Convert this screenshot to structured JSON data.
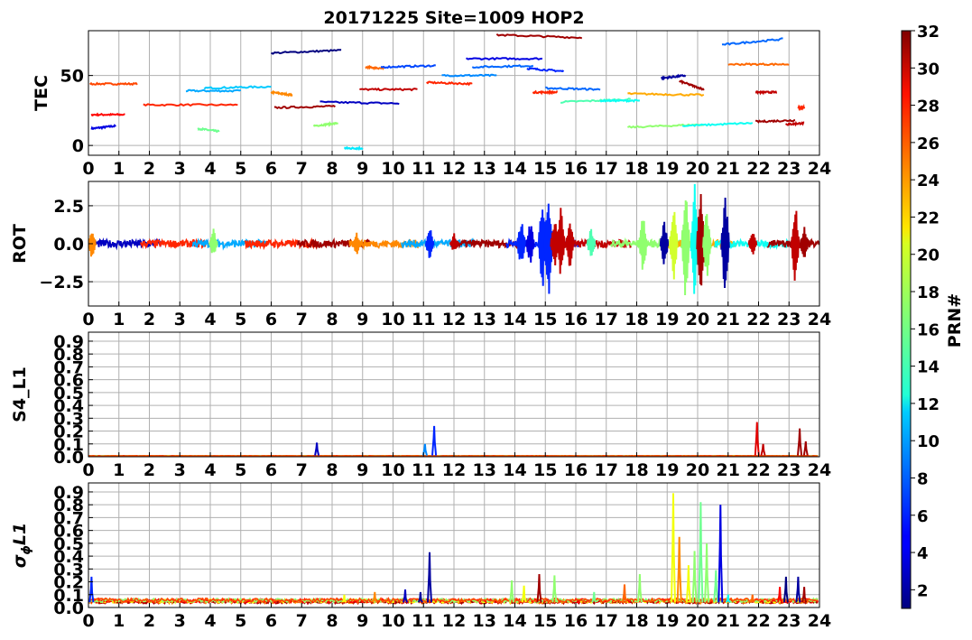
{
  "figure": {
    "title": "20171225 Site=1009 HOP2"
  },
  "chart_data": [
    {
      "type": "line",
      "panel": "TEC",
      "ylabel": "TEC",
      "xlim": [
        0,
        24
      ],
      "ylim": [
        -7,
        82
      ],
      "xticks": [
        0,
        1,
        2,
        3,
        4,
        5,
        6,
        7,
        8,
        9,
        10,
        11,
        12,
        13,
        14,
        15,
        16,
        17,
        18,
        19,
        20,
        21,
        22,
        23,
        24
      ],
      "yticks": [
        0,
        50
      ],
      "grid": true,
      "series": [
        {
          "prn": 4,
          "x": [
            0.1,
            0.9
          ],
          "y": [
            12,
            14
          ]
        },
        {
          "prn": 28,
          "x": [
            0.1,
            1.2
          ],
          "y": [
            22,
            22
          ]
        },
        {
          "prn": 26,
          "x": [
            0.05,
            1.6
          ],
          "y": [
            44,
            44
          ]
        },
        {
          "prn": 27,
          "x": [
            1.8,
            4.9
          ],
          "y": [
            29,
            29
          ]
        },
        {
          "prn": 10,
          "x": [
            3.2,
            5.0
          ],
          "y": [
            39,
            39
          ]
        },
        {
          "prn": 11,
          "x": [
            3.8,
            6.0
          ],
          "y": [
            41,
            42
          ]
        },
        {
          "prn": 16,
          "x": [
            3.6,
            4.3
          ],
          "y": [
            12,
            10
          ]
        },
        {
          "prn": 24,
          "x": [
            6.0,
            6.7
          ],
          "y": [
            38,
            36
          ]
        },
        {
          "prn": 1,
          "x": [
            6.0,
            8.3
          ],
          "y": [
            66,
            68
          ]
        },
        {
          "prn": 31,
          "x": [
            6.1,
            8.1
          ],
          "y": [
            27,
            28
          ]
        },
        {
          "prn": 17,
          "x": [
            7.4,
            8.2
          ],
          "y": [
            14,
            16
          ]
        },
        {
          "prn": 3,
          "x": [
            7.6,
            10.2
          ],
          "y": [
            31,
            30
          ]
        },
        {
          "prn": 12,
          "x": [
            8.4,
            9.0
          ],
          "y": [
            -2,
            -2
          ]
        },
        {
          "prn": 30,
          "x": [
            8.9,
            10.8
          ],
          "y": [
            40,
            40
          ]
        },
        {
          "prn": 25,
          "x": [
            9.1,
            9.7
          ],
          "y": [
            56,
            55
          ]
        },
        {
          "prn": 7,
          "x": [
            9.6,
            11.4
          ],
          "y": [
            56,
            57
          ]
        },
        {
          "prn": 27,
          "x": [
            11.1,
            12.6
          ],
          "y": [
            45,
            44
          ]
        },
        {
          "prn": 9,
          "x": [
            11.6,
            13.4
          ],
          "y": [
            50,
            50
          ]
        },
        {
          "prn": 4,
          "x": [
            12.4,
            14.9
          ],
          "y": [
            62,
            62
          ]
        },
        {
          "prn": 8,
          "x": [
            12.6,
            14.6
          ],
          "y": [
            56,
            57
          ]
        },
        {
          "prn": 31,
          "x": [
            13.4,
            16.2
          ],
          "y": [
            79,
            77
          ]
        },
        {
          "prn": 6,
          "x": [
            14.4,
            15.6
          ],
          "y": [
            55,
            53
          ]
        },
        {
          "prn": 27,
          "x": [
            14.6,
            15.4
          ],
          "y": [
            38,
            38
          ]
        },
        {
          "prn": 8,
          "x": [
            15.0,
            16.8
          ],
          "y": [
            41,
            40
          ]
        },
        {
          "prn": 15,
          "x": [
            15.5,
            17.8
          ],
          "y": [
            31,
            33
          ]
        },
        {
          "prn": 13,
          "x": [
            16.8,
            18.1
          ],
          "y": [
            32,
            32
          ]
        },
        {
          "prn": 23,
          "x": [
            17.7,
            20.2
          ],
          "y": [
            37,
            36
          ]
        },
        {
          "prn": 17,
          "x": [
            17.7,
            20.2
          ],
          "y": [
            13,
            15
          ]
        },
        {
          "prn": 2,
          "x": [
            18.8,
            19.6
          ],
          "y": [
            48,
            50
          ]
        },
        {
          "prn": 31,
          "x": [
            19.4,
            20.2
          ],
          "y": [
            46,
            40
          ]
        },
        {
          "prn": 13,
          "x": [
            19.5,
            21.8
          ],
          "y": [
            14,
            16
          ]
        },
        {
          "prn": 8,
          "x": [
            20.8,
            22.8
          ],
          "y": [
            72,
            76
          ]
        },
        {
          "prn": 25,
          "x": [
            21.0,
            23.0
          ],
          "y": [
            58,
            58
          ]
        },
        {
          "prn": 30,
          "x": [
            21.9,
            22.6
          ],
          "y": [
            38,
            38
          ]
        },
        {
          "prn": 31,
          "x": [
            21.9,
            23.2
          ],
          "y": [
            17,
            18
          ]
        },
        {
          "prn": 30,
          "x": [
            22.9,
            23.5
          ],
          "y": [
            15,
            16
          ]
        },
        {
          "prn": 27,
          "x": [
            23.3,
            23.5
          ],
          "y": [
            27,
            27
          ]
        }
      ]
    },
    {
      "type": "line",
      "panel": "ROT",
      "ylabel": "ROT",
      "xlim": [
        0,
        24
      ],
      "ylim": [
        -4.1,
        4.1
      ],
      "xticks": [
        0,
        1,
        2,
        3,
        4,
        5,
        6,
        7,
        8,
        9,
        10,
        11,
        12,
        13,
        14,
        15,
        16,
        17,
        18,
        19,
        20,
        21,
        22,
        23,
        24
      ],
      "yticks": [
        -2.5,
        0.0,
        2.5
      ],
      "ytick_labels": [
        "−2.5",
        "0.0",
        "2.5"
      ],
      "grid": true,
      "bursts": [
        {
          "x": 0.1,
          "amp": 1.2,
          "prn": 24
        },
        {
          "x": 4.1,
          "amp": 1.0,
          "prn": 17
        },
        {
          "x": 8.8,
          "amp": 0.8,
          "prn": 24
        },
        {
          "x": 11.2,
          "amp": 1.3,
          "prn": 6
        },
        {
          "x": 12.0,
          "amp": 0.7,
          "prn": 30
        },
        {
          "x": 14.2,
          "amp": 1.8,
          "prn": 6
        },
        {
          "x": 14.5,
          "amp": 1.6,
          "prn": 4
        },
        {
          "x": 14.9,
          "amp": 3.2,
          "prn": 6
        },
        {
          "x": 15.1,
          "amp": 3.8,
          "prn": 6
        },
        {
          "x": 15.3,
          "amp": 2.0,
          "prn": 30
        },
        {
          "x": 15.5,
          "amp": 2.5,
          "prn": 30
        },
        {
          "x": 15.8,
          "amp": 1.8,
          "prn": 30
        },
        {
          "x": 16.5,
          "amp": 1.2,
          "prn": 15
        },
        {
          "x": 18.2,
          "amp": 2.1,
          "prn": 17
        },
        {
          "x": 18.9,
          "amp": 1.7,
          "prn": 2
        },
        {
          "x": 19.2,
          "amp": 2.8,
          "prn": 19
        },
        {
          "x": 19.6,
          "amp": 3.9,
          "prn": 17
        },
        {
          "x": 19.9,
          "amp": 4.0,
          "prn": 13
        },
        {
          "x": 20.1,
          "amp": 3.9,
          "prn": 31
        },
        {
          "x": 20.3,
          "amp": 2.5,
          "prn": 17
        },
        {
          "x": 20.9,
          "amp": 3.8,
          "prn": 2
        },
        {
          "x": 21.8,
          "amp": 0.9,
          "prn": 30
        },
        {
          "x": 23.2,
          "amp": 2.9,
          "prn": 30
        },
        {
          "x": 23.5,
          "amp": 1.4,
          "prn": 31
        }
      ]
    },
    {
      "type": "line",
      "panel": "S4",
      "ylabel": "S4_L1",
      "xlim": [
        0,
        24
      ],
      "ylim": [
        0,
        0.97
      ],
      "xticks": [
        0,
        1,
        2,
        3,
        4,
        5,
        6,
        7,
        8,
        9,
        10,
        11,
        12,
        13,
        14,
        15,
        16,
        17,
        18,
        19,
        20,
        21,
        22,
        23,
        24
      ],
      "yticks": [
        0.0,
        0.1,
        0.2,
        0.3,
        0.4,
        0.5,
        0.6,
        0.7,
        0.8,
        0.9
      ],
      "ytick_labels": [
        "0.0",
        "0.1",
        "0.2",
        "0.3",
        "0.4",
        "0.5",
        "0.6",
        "0.7",
        "0.8",
        "0.9"
      ],
      "grid": true,
      "spikes": [
        {
          "x": 7.5,
          "y": 0.11,
          "prn": 3
        },
        {
          "x": 11.05,
          "y": 0.1,
          "prn": 9
        },
        {
          "x": 11.35,
          "y": 0.24,
          "prn": 6
        },
        {
          "x": 21.95,
          "y": 0.27,
          "prn": 29
        },
        {
          "x": 22.15,
          "y": 0.1,
          "prn": 30
        },
        {
          "x": 23.35,
          "y": 0.22,
          "prn": 31
        },
        {
          "x": 23.55,
          "y": 0.12,
          "prn": 31
        }
      ]
    },
    {
      "type": "line",
      "panel": "sigma_phi",
      "ylabel": "σ",
      "ylabel_sub": "ϕ",
      "ylabel_suffix": "L1",
      "xlim": [
        0,
        24
      ],
      "ylim": [
        0,
        0.97
      ],
      "xticks": [
        0,
        1,
        2,
        3,
        4,
        5,
        6,
        7,
        8,
        9,
        10,
        11,
        12,
        13,
        14,
        15,
        16,
        17,
        18,
        19,
        20,
        21,
        22,
        23,
        24
      ],
      "yticks": [
        0.0,
        0.1,
        0.2,
        0.3,
        0.4,
        0.5,
        0.6,
        0.7,
        0.8,
        0.9
      ],
      "ytick_labels": [
        "0.0",
        "0.1",
        "0.2",
        "0.3",
        "0.4",
        "0.5",
        "0.6",
        "0.7",
        "0.8",
        "0.9"
      ],
      "grid": true,
      "spikes": [
        {
          "x": 0.1,
          "y": 0.24,
          "prn": 6
        },
        {
          "x": 8.4,
          "y": 0.1,
          "prn": 20
        },
        {
          "x": 9.4,
          "y": 0.12,
          "prn": 24
        },
        {
          "x": 10.4,
          "y": 0.14,
          "prn": 3
        },
        {
          "x": 10.9,
          "y": 0.12,
          "prn": 2
        },
        {
          "x": 11.2,
          "y": 0.43,
          "prn": 2
        },
        {
          "x": 13.9,
          "y": 0.21,
          "prn": 17
        },
        {
          "x": 14.3,
          "y": 0.17,
          "prn": 20
        },
        {
          "x": 14.8,
          "y": 0.26,
          "prn": 31
        },
        {
          "x": 15.3,
          "y": 0.25,
          "prn": 17
        },
        {
          "x": 16.6,
          "y": 0.12,
          "prn": 16
        },
        {
          "x": 17.6,
          "y": 0.18,
          "prn": 25
        },
        {
          "x": 18.1,
          "y": 0.26,
          "prn": 17
        },
        {
          "x": 19.2,
          "y": 0.89,
          "prn": 20
        },
        {
          "x": 19.4,
          "y": 0.55,
          "prn": 24
        },
        {
          "x": 19.7,
          "y": 0.33,
          "prn": 20
        },
        {
          "x": 19.9,
          "y": 0.44,
          "prn": 17
        },
        {
          "x": 20.1,
          "y": 0.82,
          "prn": 16
        },
        {
          "x": 20.3,
          "y": 0.5,
          "prn": 17
        },
        {
          "x": 20.6,
          "y": 0.29,
          "prn": 16
        },
        {
          "x": 20.75,
          "y": 0.8,
          "prn": 4
        },
        {
          "x": 21.0,
          "y": 0.1,
          "prn": 13
        },
        {
          "x": 21.8,
          "y": 0.1,
          "prn": 25
        },
        {
          "x": 22.7,
          "y": 0.16,
          "prn": 28
        },
        {
          "x": 22.9,
          "y": 0.24,
          "prn": 1
        },
        {
          "x": 23.3,
          "y": 0.24,
          "prn": 2
        },
        {
          "x": 23.5,
          "y": 0.16,
          "prn": 31
        }
      ]
    }
  ],
  "colorbar": {
    "label": "PRN#",
    "min": 1,
    "max": 32,
    "ticks": [
      2,
      4,
      6,
      8,
      10,
      12,
      14,
      16,
      18,
      20,
      22,
      24,
      26,
      28,
      30,
      32
    ],
    "colormap": "jet"
  }
}
